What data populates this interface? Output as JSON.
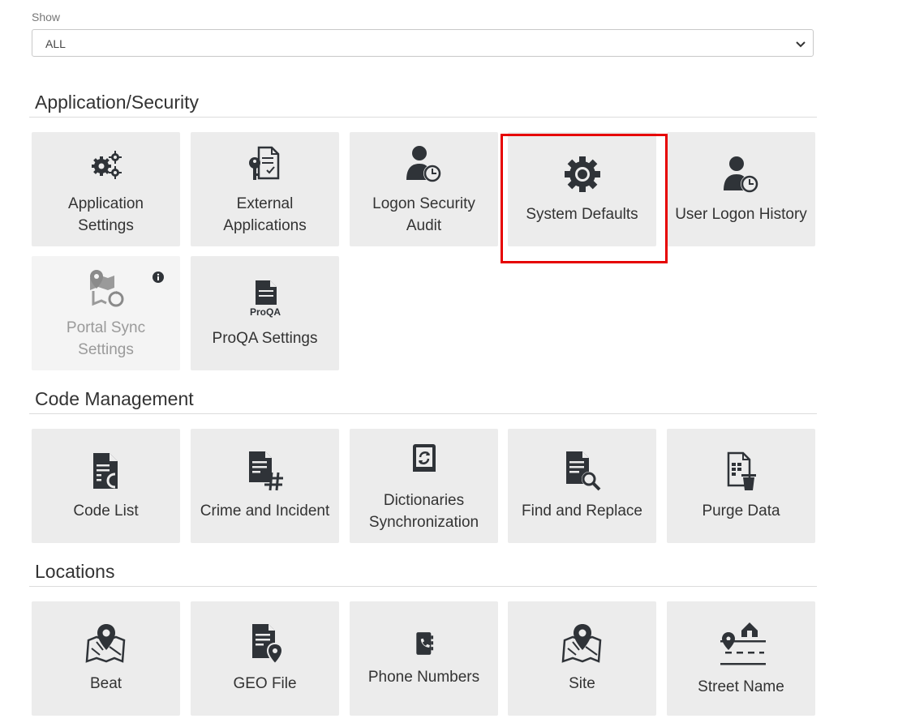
{
  "filter": {
    "label": "Show",
    "selected": "ALL"
  },
  "sections": {
    "app_security": {
      "title": "Application/Security",
      "tiles": [
        {
          "label": "Application Settings",
          "icon": "gears-icon"
        },
        {
          "label": "External Applications",
          "icon": "key-document-icon"
        },
        {
          "label": "Logon Security Audit",
          "icon": "user-clock-icon"
        },
        {
          "label": "System Defaults",
          "icon": "gear-icon",
          "highlighted": true
        },
        {
          "label": "User Logon History",
          "icon": "user-clock-icon"
        },
        {
          "label": "Portal Sync Settings",
          "icon": "map-sync-icon",
          "disabled": true
        },
        {
          "label": "ProQA Settings",
          "icon": "proqa-document-icon",
          "icon_text": "ProQA"
        }
      ]
    },
    "code_mgmt": {
      "title": "Code Management",
      "tiles": [
        {
          "label": "Code List",
          "icon": "code-list-icon"
        },
        {
          "label": "Crime and Incident",
          "icon": "document-hashtag-icon"
        },
        {
          "label": "Dictionaries Synchronization",
          "icon": "book-sync-icon"
        },
        {
          "label": "Find and Replace",
          "icon": "document-search-icon"
        },
        {
          "label": "Purge Data",
          "icon": "document-trash-icon"
        }
      ]
    },
    "locations": {
      "title": "Locations",
      "tiles": [
        {
          "label": "Beat",
          "icon": "map-pin-icon"
        },
        {
          "label": "GEO File",
          "icon": "document-pin-icon"
        },
        {
          "label": "Phone Numbers",
          "icon": "phone-book-icon"
        },
        {
          "label": "Site",
          "icon": "map-pin-icon"
        },
        {
          "label": "Street Name",
          "icon": "street-house-icon"
        }
      ]
    }
  },
  "colors": {
    "tile_bg": "#ececec",
    "icon": "#2f3338",
    "highlight": "#e60000",
    "disabled_text": "#9a9a9a"
  }
}
